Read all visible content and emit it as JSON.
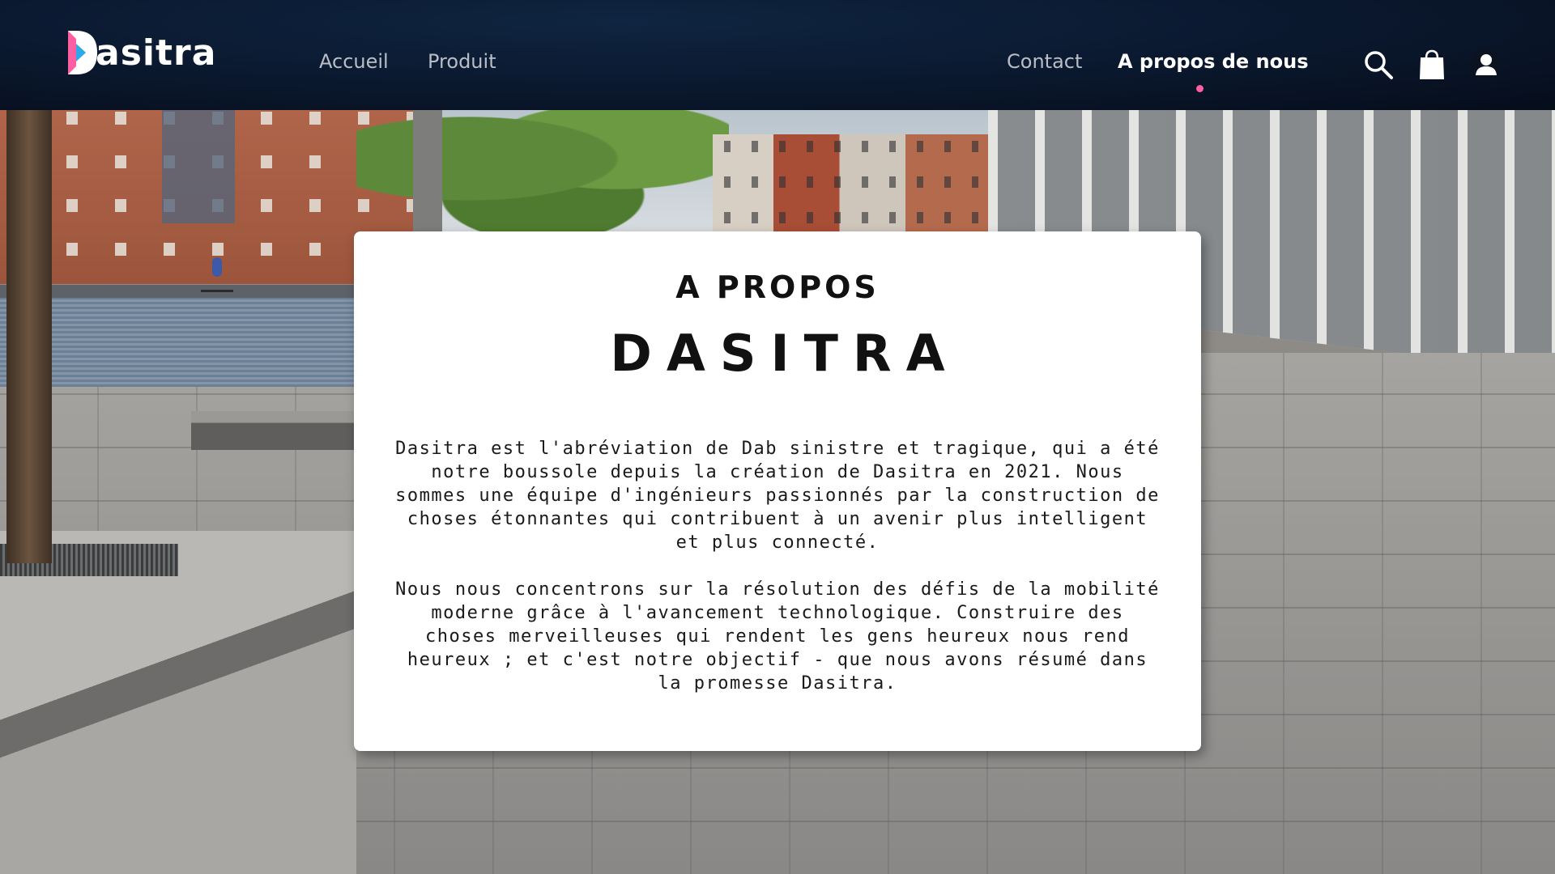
{
  "brand": {
    "name": "Dasitra",
    "logo_letter_rest": "asitra",
    "accent_pink": "#ff5fa2",
    "accent_blue": "#2ea8e6",
    "header_bg": "#0b1a31"
  },
  "nav": {
    "left": [
      {
        "label": "Accueil"
      },
      {
        "label": "Produit"
      }
    ],
    "right": [
      {
        "label": "Contact"
      },
      {
        "label": "A propos de nous",
        "active": true
      }
    ],
    "icons": [
      "search-icon",
      "shopping-bag-icon",
      "user-icon"
    ]
  },
  "about": {
    "subtitle": "A PROPOS",
    "title": "DASITRA",
    "paragraph_1": "Dasitra est l'abréviation de Dab sinistre et tragique, qui a été notre boussole depuis la création de Dasitra en 2021. Nous sommes une équipe d'ingénieurs passionnés par la construction de choses étonnantes qui contribuent à un avenir plus intelligent et plus connecté.",
    "paragraph_2": "Nous nous concentrons sur la résolution des défis de la mobilité moderne grâce à l'avancement technologique. Construire des choses merveilleuses qui rendent les gens heureux nous rend heureux ; et c'est notre objectif - que nous avons résumé dans la promesse Dasitra."
  }
}
